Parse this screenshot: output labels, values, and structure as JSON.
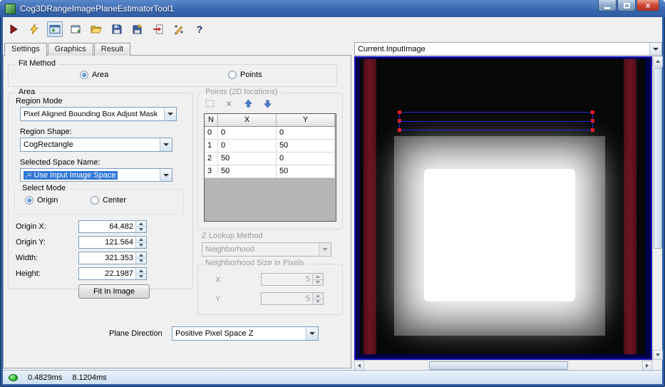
{
  "window": {
    "title": "Cog3DRangeImagePlaneEstimatorTool1"
  },
  "toolbar": {
    "icons": [
      "run-icon",
      "electric-icon",
      "interactive-graphics-icon",
      "floating-window-icon",
      "open-folder-icon",
      "save-icon",
      "save-image-icon",
      "import-icon",
      "edit-icon",
      "help-icon"
    ]
  },
  "tabs": {
    "items": [
      {
        "label": "Settings"
      },
      {
        "label": "Graphics"
      },
      {
        "label": "Result"
      }
    ],
    "active": "Settings"
  },
  "fit_method": {
    "label": "Fit Method",
    "area_option": "Area",
    "points_option": "Points",
    "selected": "Area"
  },
  "area": {
    "label": "Area",
    "region_mode_label": "Region Mode",
    "region_mode_value": "Pixel Aligned Bounding Box Adjust Mask",
    "region_shape_label": "Region Shape:",
    "region_shape_value": "CogRectangle",
    "selected_space_label": "Selected Space Name:",
    "selected_space_value": ".= Use Input Image Space",
    "select_mode_label": "Select Mode",
    "origin_option": "Origin",
    "center_option": "Center",
    "selected_mode": "Origin",
    "origin_x_label": "Origin X:",
    "origin_x_value": "64.482",
    "origin_y_label": "Origin Y:",
    "origin_y_value": "121.564",
    "width_label": "Width:",
    "width_value": "321.353",
    "height_label": "Height:",
    "height_value": "22.1987",
    "fit_in_image_button": "Fit In Image"
  },
  "points": {
    "label": "Points (2D locations)",
    "columns": [
      "N",
      "X",
      "Y"
    ],
    "rows": [
      {
        "n": "0",
        "x": "0",
        "y": "0"
      },
      {
        "n": "1",
        "x": "0",
        "y": "50"
      },
      {
        "n": "2",
        "x": "50",
        "y": "0"
      },
      {
        "n": "3",
        "x": "50",
        "y": "50"
      }
    ]
  },
  "z_lookup": {
    "label": "Z Lookup Method",
    "value": "Neighborhood"
  },
  "neighborhood": {
    "label": "Neighborhood Size In Pixels",
    "x_label": "X",
    "x_value": "5",
    "y_label": "Y",
    "y_value": "5"
  },
  "plane_direction": {
    "label": "Plane Direction",
    "value": "Positive Pixel Space Z"
  },
  "image_panel": {
    "source": "Current.InputImage"
  },
  "status": {
    "time1": "0.4829ms",
    "time2": "8.1204ms"
  },
  "colors": {
    "title_bar": "#2e5ca4",
    "close_button": "#c23b2e",
    "selection_highlight": "#3078d7",
    "region_outline": "#2626d8",
    "region_handle": "#e81c1c",
    "image_stripe": "#6e1322",
    "status_led": "#2db82d"
  }
}
